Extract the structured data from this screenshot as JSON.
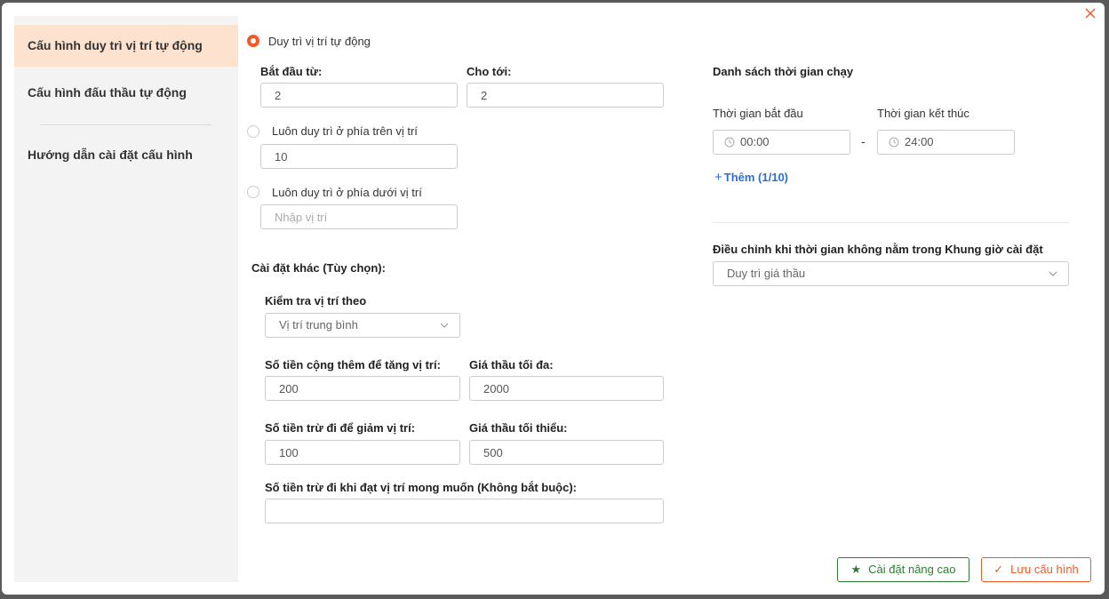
{
  "sidebar": {
    "items": [
      {
        "label": "Cấu hình duy trì vị trí tự động"
      },
      {
        "label": "Cấu hình đấu thầu tự động"
      },
      {
        "label": "Hướng dẫn cài đặt cấu hình"
      }
    ]
  },
  "position": {
    "mode_auto_label": "Duy trì vị trí tự động",
    "from_label": "Bắt đầu từ:",
    "from_value": "2",
    "to_label": "Cho tới:",
    "to_value": "2",
    "above_label": "Luôn duy trì ở phía trên vị trí",
    "above_value": "10",
    "below_label": "Luôn duy trì ở phía dưới vị trí",
    "below_placeholder": "Nhập vị trí"
  },
  "other": {
    "title": "Cài đặt khác (Tùy chọn):",
    "check_label": "Kiểm tra vị trí theo",
    "check_value": "Vị trí trung bình",
    "increase_label": "Số tiền cộng thêm để tăng vị trí:",
    "increase_value": "200",
    "max_bid_label": "Giá thầu tối đa:",
    "max_bid_value": "2000",
    "decrease_label": "Số tiền trừ đi để giảm vị trí:",
    "decrease_value": "100",
    "min_bid_label": "Giá thầu tối thiểu:",
    "min_bid_value": "500",
    "desired_label": "Số tiền trừ đi khi đạt vị trí mong muốn (Không bắt buộc):",
    "desired_value": ""
  },
  "schedule": {
    "title": "Danh sách thời gian chạy",
    "start_label": "Thời gian bắt đầu",
    "end_label": "Thời gian kết thúc",
    "start_value": "00:00",
    "end_value": "24:00",
    "separator": "-",
    "add_label": "Thêm (1/10)",
    "adjust_label": "Điều chỉnh khi thời gian không nằm trong Khung giờ cài đặt",
    "adjust_value": "Duy trì giá thầu"
  },
  "footer": {
    "advanced_label": "Cài đặt nâng cao",
    "save_label": "Lưu cấu hình"
  },
  "colors": {
    "accent": "#f05a28",
    "active_bg": "#fde3cf",
    "success": "#2e7d32",
    "link": "#2a6fd6"
  }
}
